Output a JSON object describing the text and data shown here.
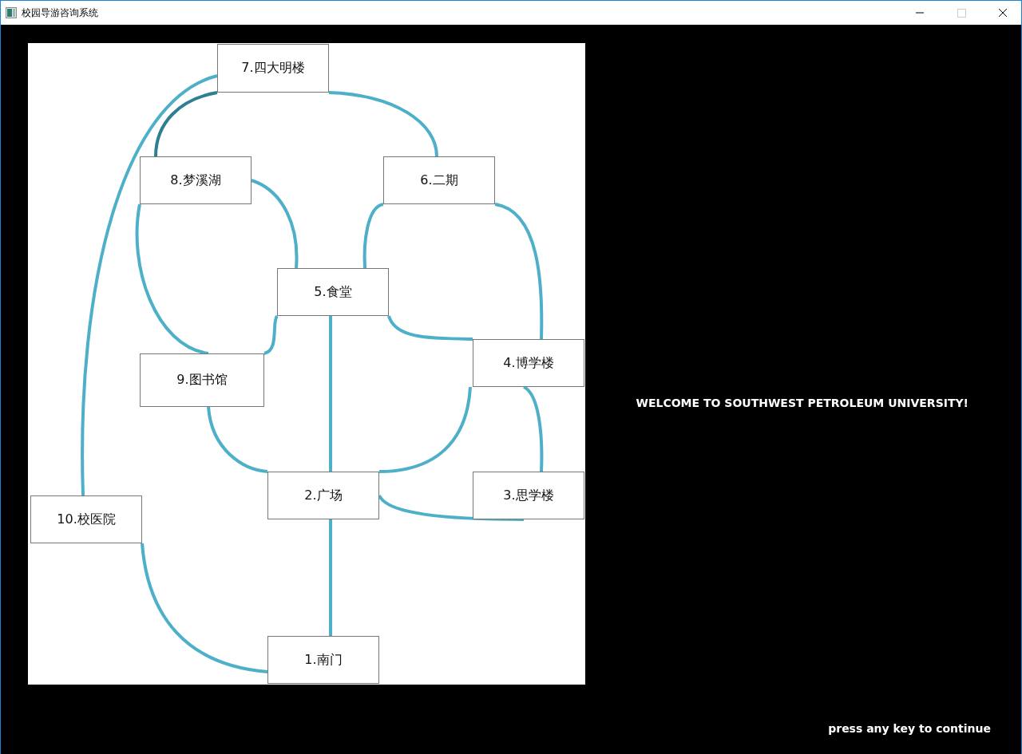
{
  "window": {
    "title": "校园导游咨询系统"
  },
  "map": {
    "nodes": [
      {
        "label": "7.四大明楼"
      },
      {
        "label": "8.梦溪湖"
      },
      {
        "label": "6.二期"
      },
      {
        "label": "5.食堂"
      },
      {
        "label": "4.博学楼"
      },
      {
        "label": "9.图书馆"
      },
      {
        "label": "2.广场"
      },
      {
        "label": "3.思学楼"
      },
      {
        "label": "10.校医院"
      },
      {
        "label": "1.南门"
      }
    ]
  },
  "welcome_text": "WELCOME TO SOUTHWEST PETROLEUM UNIVERSITY!",
  "prompt": "press any key to continue"
}
